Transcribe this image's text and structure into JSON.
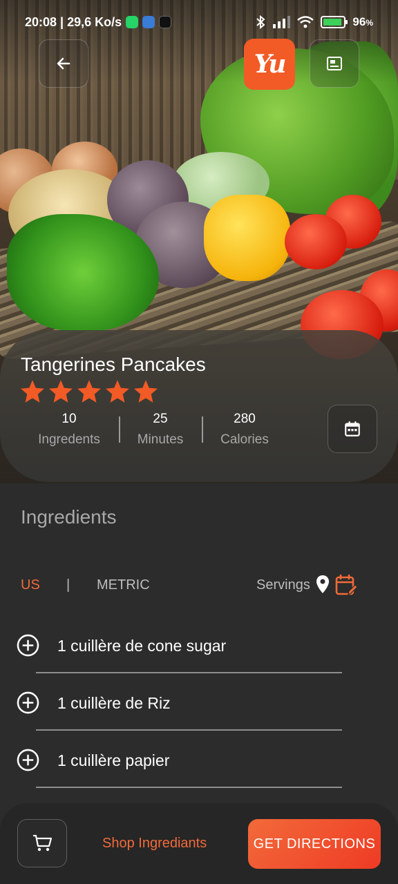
{
  "status_bar": {
    "time_speed": "20:08 | 29,6 Ko/s",
    "battery": "96",
    "battery_unit": "%"
  },
  "header": {
    "logo_text": "Yu",
    "back_icon": "arrow-left-icon",
    "image_icon": "image-card-icon"
  },
  "recipe": {
    "title": "Tangerines Pancakes",
    "rating": 5,
    "rating_max": 5,
    "stats": [
      {
        "value": "10",
        "label": "Ingredents"
      },
      {
        "value": "25",
        "label": "Minutes"
      },
      {
        "value": "280",
        "label": "Calories"
      }
    ]
  },
  "ingredients": {
    "section_title": "Ingredients",
    "unit_us": "US",
    "unit_separator": "|",
    "unit_metric": "METRIC",
    "selected_unit": "US",
    "servings_label": "Servings",
    "items": [
      {
        "text": "1 cuillère de cone sugar"
      },
      {
        "text": "1 cuillère de Riz"
      },
      {
        "text": "1 cuillère papier"
      }
    ]
  },
  "bottom_bar": {
    "shop_label": "Shop Ingrediants",
    "directions_label": "GET DIRECTIONS"
  },
  "colors": {
    "accent": "#f26a3a",
    "background": "#2b2c2b",
    "star": "#f25a26"
  }
}
